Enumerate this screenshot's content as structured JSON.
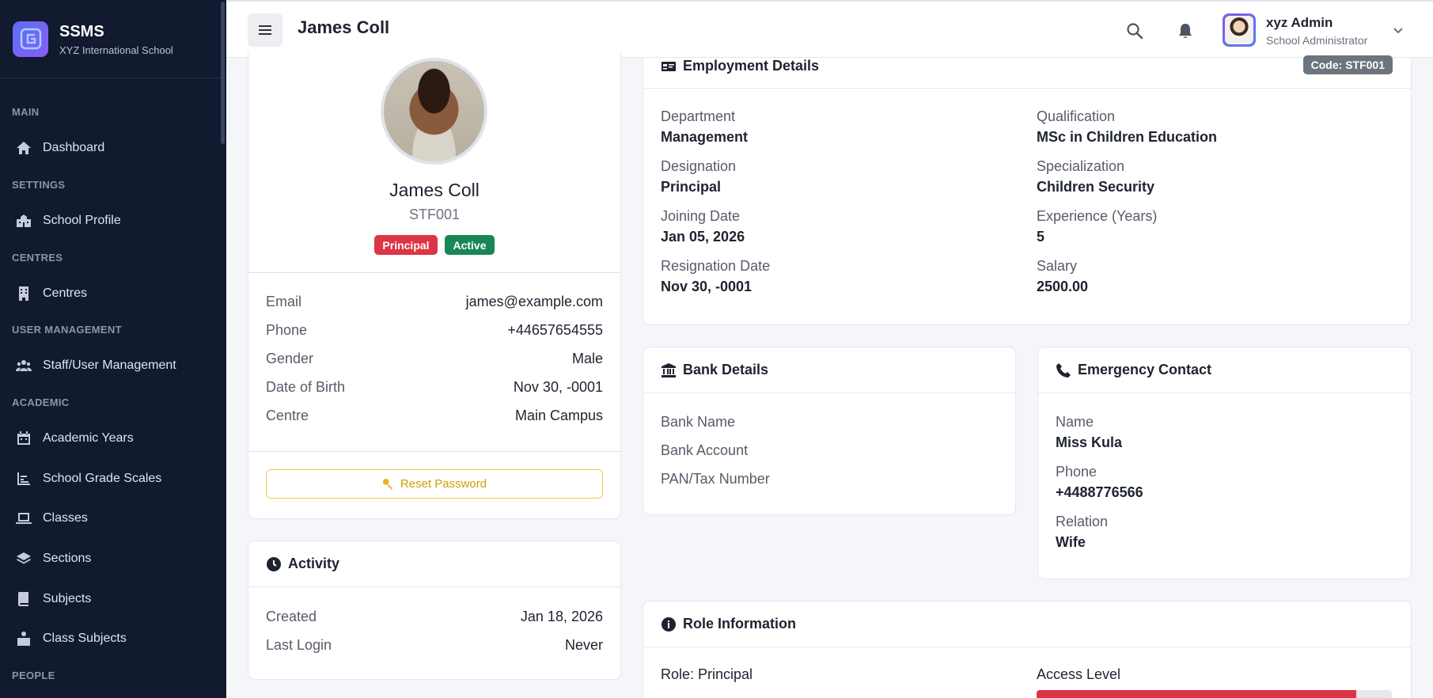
{
  "sidebar": {
    "brand_title": "SSMS",
    "brand_subtitle": "XYZ International School",
    "sections": [
      "MAIN",
      "SETTINGS",
      "CENTRES",
      "USER MANAGEMENT",
      "ACADEMIC",
      "PEOPLE"
    ],
    "items": [
      {
        "label": "Dashboard",
        "icon": "home-icon"
      },
      {
        "label": "School Profile",
        "icon": "school-icon"
      },
      {
        "label": "Centres",
        "icon": "building-icon"
      },
      {
        "label": "Staff/User Management",
        "icon": "users-icon"
      },
      {
        "label": "Academic Years",
        "icon": "calendar-icon"
      },
      {
        "label": "School Grade Scales",
        "icon": "chart-icon"
      },
      {
        "label": "Classes",
        "icon": "laptop-icon"
      },
      {
        "label": "Sections",
        "icon": "layers-icon"
      },
      {
        "label": "Subjects",
        "icon": "book-icon"
      },
      {
        "label": "Class Subjects",
        "icon": "briefcase-icon"
      }
    ]
  },
  "topbar": {
    "title": "James Coll",
    "user_name": "xyz Admin",
    "user_role": "School Administrator"
  },
  "profile": {
    "name": "James Coll",
    "code": "STF001",
    "role_badge": "Principal",
    "status_badge": "Active",
    "role_badge_color": "#dc3545",
    "status_badge_color": "#198754",
    "details": [
      {
        "key": "Email",
        "value": "james@example.com"
      },
      {
        "key": "Phone",
        "value": "+44657654555"
      },
      {
        "key": "Gender",
        "value": "Male"
      },
      {
        "key": "Date of Birth",
        "value": "Nov 30, -0001"
      },
      {
        "key": "Centre",
        "value": "Main Campus"
      }
    ],
    "reset_password_label": "Reset Password"
  },
  "activity": {
    "title": "Activity",
    "rows": [
      {
        "key": "Created",
        "value": "Jan 18, 2026"
      },
      {
        "key": "Last Login",
        "value": "Never"
      }
    ]
  },
  "employment": {
    "title": "Employment Details",
    "code_badge": "Code: STF001",
    "left": [
      {
        "label": "Department",
        "value": "Management"
      },
      {
        "label": "Designation",
        "value": "Principal"
      },
      {
        "label": "Joining Date",
        "value": "Jan 05, 2026"
      },
      {
        "label": "Resignation Date",
        "value": "Nov 30, -0001"
      }
    ],
    "right": [
      {
        "label": "Qualification",
        "value": "MSc in Children Education"
      },
      {
        "label": "Specialization",
        "value": "Children Security"
      },
      {
        "label": "Experience (Years)",
        "value": "5"
      },
      {
        "label": "Salary",
        "value": "2500.00"
      }
    ]
  },
  "bank": {
    "title": "Bank Details",
    "labels": [
      "Bank Name",
      "Bank Account",
      "PAN/Tax Number"
    ]
  },
  "emergency": {
    "title": "Emergency Contact",
    "fields": [
      {
        "label": "Name",
        "value": "Miss Kula"
      },
      {
        "label": "Phone",
        "value": "+4488776566"
      },
      {
        "label": "Relation",
        "value": "Wife"
      }
    ]
  },
  "role_info": {
    "title": "Role Information",
    "role_label": "Role: Principal",
    "access_label": "Access Level",
    "access_level_fraction": 0.9,
    "access_color": "#dc3545"
  }
}
